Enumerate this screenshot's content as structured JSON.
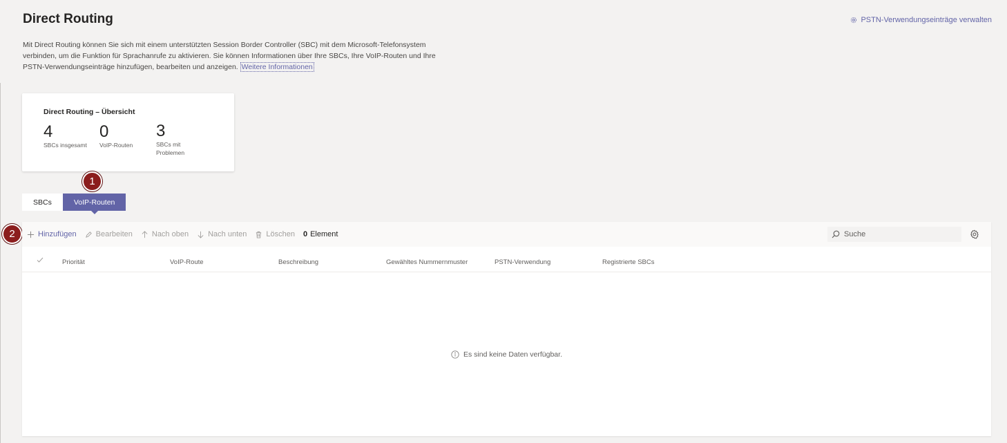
{
  "header": {
    "title": "Direct Routing",
    "manage_link": "PSTN-Verwendungseinträge verwalten",
    "description": "Mit Direct Routing können Sie sich mit einem unterstützten Session Border Controller (SBC) mit dem Microsoft-Telefonsystem verbinden, um die Funktion für Sprachanrufe zu aktivieren. Sie können Informationen über Ihre SBCs, Ihre VoIP-Routen und Ihre PSTN-Verwendungseinträge hinzufügen, bearbeiten und anzeigen. ",
    "more_info_link": "Weitere Informationen"
  },
  "overview": {
    "title": "Direct Routing – Übersicht",
    "metrics": [
      {
        "value": "4",
        "label": "SBCs insgesamt"
      },
      {
        "value": "0",
        "label": "VoIP-Routen"
      },
      {
        "value": "3",
        "label_line1": "SBCs mit",
        "label_line2": "Problemen"
      }
    ]
  },
  "callouts": [
    "1",
    "2"
  ],
  "tabs": [
    {
      "label": "SBCs",
      "active": false
    },
    {
      "label": "VoIP-Routen",
      "active": true
    }
  ],
  "toolbar": {
    "add": "Hinzufügen",
    "edit": "Bearbeiten",
    "move_up": "Nach oben",
    "move_down": "Nach unten",
    "delete": "Löschen",
    "count_value": "0",
    "count_label": "Element"
  },
  "search": {
    "placeholder": "Suche"
  },
  "table": {
    "columns": [
      "Priorität",
      "VoIP-Route",
      "Beschreibung",
      "Gewähltes Nummernmuster",
      "PSTN-Verwendung",
      "Registrierte SBCs"
    ],
    "empty_text": "Es sind keine Daten verfügbar."
  },
  "colors": {
    "accent": "#6264a7",
    "callout": "#8b1d1d",
    "background": "#f3f2f1"
  },
  "icons": [
    "gear-icon",
    "plus-icon",
    "pencil-icon",
    "arrow-up-icon",
    "arrow-down-icon",
    "trash-icon",
    "search-icon",
    "settings-icon",
    "checkmark-icon",
    "info-icon"
  ]
}
